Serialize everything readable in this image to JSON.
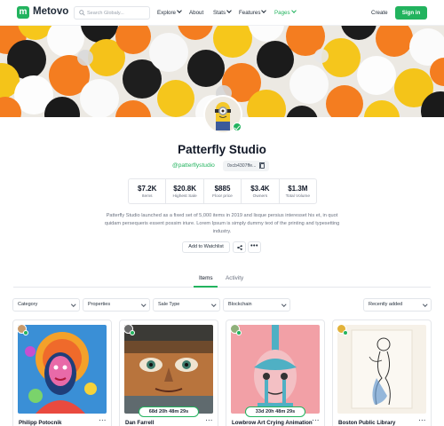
{
  "header": {
    "logo_letter": "m",
    "logo_text": "Metovo",
    "search_placeholder": "Search Globaly...",
    "nav": [
      {
        "label": "Explore",
        "has_chevron": true
      },
      {
        "label": "About",
        "has_chevron": false
      },
      {
        "label": "Stats",
        "has_chevron": true
      },
      {
        "label": "Features",
        "has_chevron": true
      },
      {
        "label": "Pages",
        "has_chevron": true,
        "active": true
      }
    ],
    "create_label": "Create",
    "signin_label": "Sign in"
  },
  "profile": {
    "name": "Patterfly Studio",
    "handle": "@patterflystudio",
    "address": "0xcb4307ffe..."
  },
  "stats": [
    {
      "value": "$7.2K",
      "label": "Items"
    },
    {
      "value": "$20.8K",
      "label": "Highest Sale"
    },
    {
      "value": "$885",
      "label": "Floor price"
    },
    {
      "value": "$3.4K",
      "label": "Owners"
    },
    {
      "value": "$1.3M",
      "label": "Total Volume"
    }
  ],
  "description": "Patterfly Studio launched as a fixed set of 5,000 items in 2019 and lisque persius interesset his et, in quot quidam persequeris essent possim iriure. Lorem Ipsum is simply dummy text of the printing and typesetting industry.",
  "actions": {
    "watchlist_label": "Add to Watchlist",
    "more_label": "•••"
  },
  "tabs": [
    {
      "label": "Items",
      "active": true
    },
    {
      "label": "Activity",
      "active": false
    }
  ],
  "filters": {
    "category": "Category",
    "properties": "Properties",
    "sale_type": "Sale Type",
    "blockchain": "Blockchain",
    "sort": "Recently added"
  },
  "cards": [
    {
      "name": "Philipp Potocnik",
      "timer": ""
    },
    {
      "name": "Dan Farrell",
      "timer": "68d  20h  48m  29s"
    },
    {
      "name": "Lowbrow Art Crying Animation",
      "timer": "33d  20h  48m  29s"
    },
    {
      "name": "Boston Public Library",
      "timer": ""
    }
  ],
  "colors": {
    "accent": "#22b35e"
  }
}
